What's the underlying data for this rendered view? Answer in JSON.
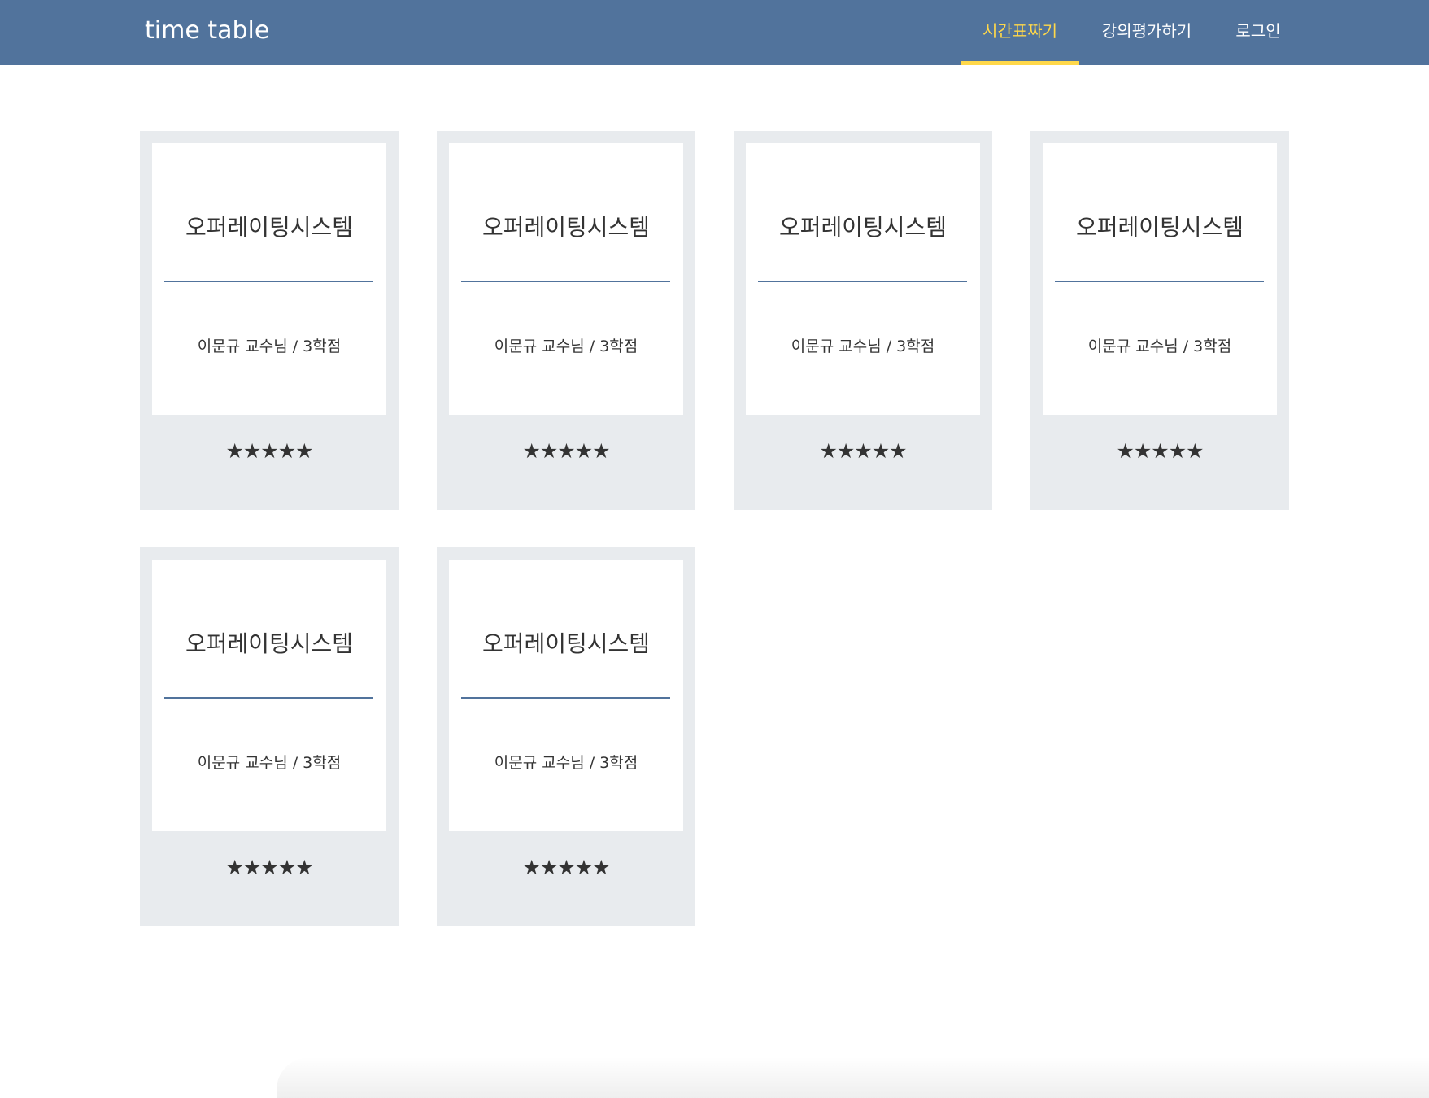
{
  "header": {
    "brand": "time table",
    "nav": [
      {
        "label": "시간표짜기",
        "active": true
      },
      {
        "label": "강의평가하기",
        "active": false
      },
      {
        "label": "로그인",
        "active": false
      }
    ]
  },
  "colors": {
    "header_bg": "#51739c",
    "active_accent": "#ffd84a",
    "card_bg": "#e8ebee",
    "card_inner_bg": "#ffffff",
    "divider": "#51739c"
  },
  "courses": [
    {
      "title": "오퍼레이팅시스템",
      "subtitle": "이문규 교수님 / 3학점",
      "stars": "★★★★★",
      "rating": 5
    },
    {
      "title": "오퍼레이팅시스템",
      "subtitle": "이문규 교수님 / 3학점",
      "stars": "★★★★★",
      "rating": 5
    },
    {
      "title": "오퍼레이팅시스템",
      "subtitle": "이문규 교수님 / 3학점",
      "stars": "★★★★★",
      "rating": 5
    },
    {
      "title": "오퍼레이팅시스템",
      "subtitle": "이문규 교수님 / 3학점",
      "stars": "★★★★★",
      "rating": 5
    },
    {
      "title": "오퍼레이팅시스템",
      "subtitle": "이문규 교수님 / 3학점",
      "stars": "★★★★★",
      "rating": 5
    },
    {
      "title": "오퍼레이팅시스템",
      "subtitle": "이문규 교수님 / 3학점",
      "stars": "★★★★★",
      "rating": 5
    }
  ]
}
